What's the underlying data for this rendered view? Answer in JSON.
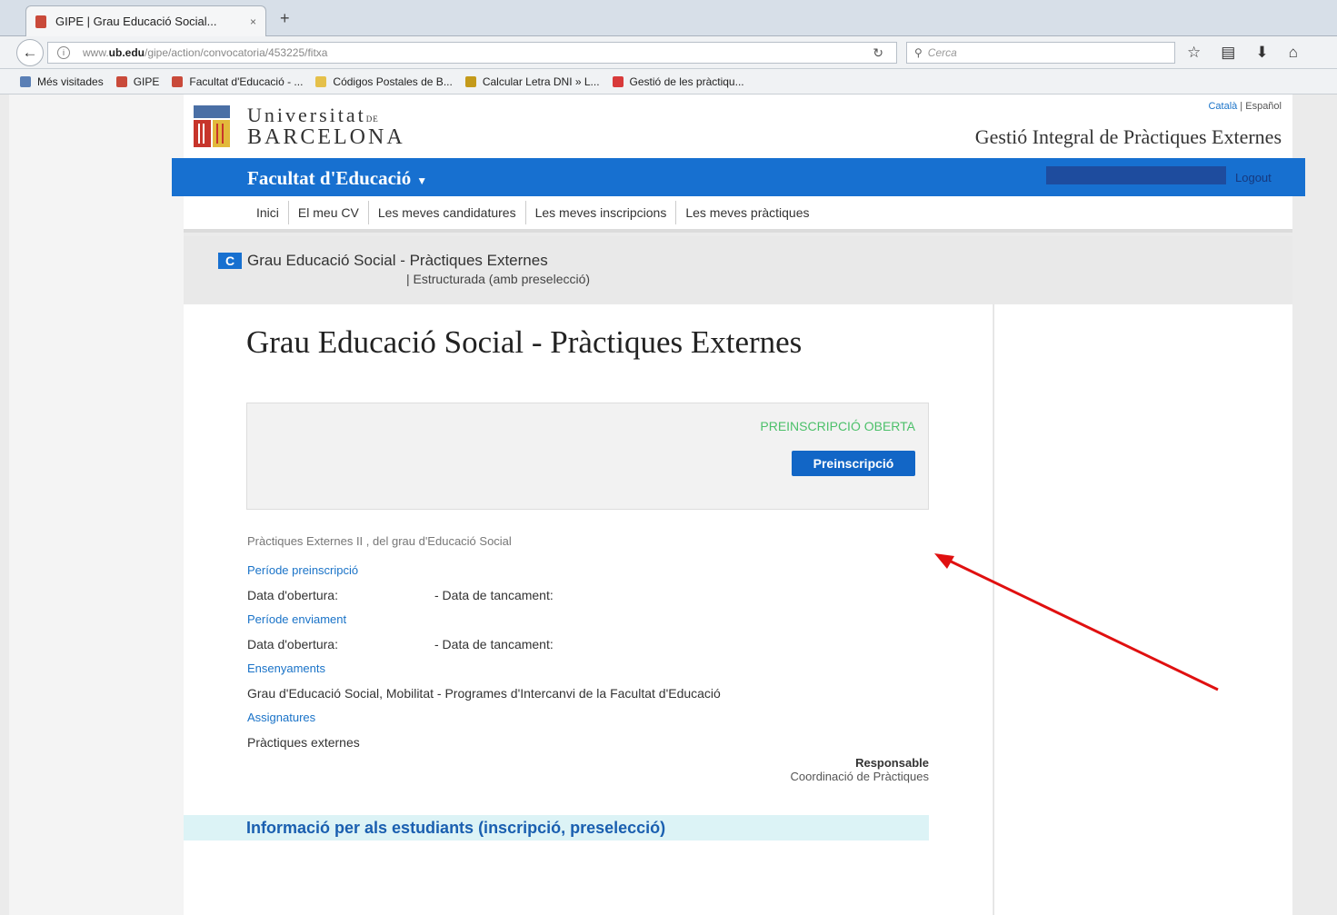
{
  "browser": {
    "tab_title": "GIPE | Grau Educació Social...",
    "tab_close": "×",
    "new_tab": "+",
    "url_prefix": "www.",
    "url_domain": "ub.edu",
    "url_path": "/gipe/action/convocatoria/453225/fitxa",
    "search_placeholder": "Cerca",
    "bookmarks": [
      {
        "label": "Més visitades",
        "color": "#5a7fb5"
      },
      {
        "label": "GIPE",
        "color": "#c94a3a"
      },
      {
        "label": "Facultat d'Educació - ...",
        "color": "#c94a3a"
      },
      {
        "label": "Códigos Postales de B...",
        "color": "#e5c04a"
      },
      {
        "label": "Calcular Letra DNI » L...",
        "color": "#c49a1a"
      },
      {
        "label": "Gestió de les pràctiqu...",
        "color": "#d83a3a"
      }
    ]
  },
  "header": {
    "uni_line1": "Universitat",
    "uni_de": "DE",
    "uni_line2": "BARCELONA",
    "lang_ca": "Català",
    "lang_sep": " | ",
    "lang_es": "Español",
    "app_title": "Gestió Integral de Pràctiques Externes"
  },
  "bluebar": {
    "faculty": "Facultat d'Educació",
    "logout": "Logout"
  },
  "menu": [
    "Inici",
    "El meu CV",
    "Les meves candidatures",
    "Les meves inscripcions",
    "Les meves pràctiques"
  ],
  "crumb": {
    "badge": "C",
    "title": "Grau Educació Social - Pràctiques Externes",
    "subtitle": "| Estructurada (amb preselecció)"
  },
  "main": {
    "title": "Grau Educació Social - Pràctiques Externes",
    "status": "PREINSCRIPCIÓ OBERTA",
    "button": "Preinscripció",
    "description": "Pràctiques Externes II , del grau d'Educació Social",
    "periode_preinscripcio": "Període preinscripció",
    "data_obertura_1": "Data d'obertura:",
    "data_tancament_1": "- Data de tancament:",
    "periode_enviament": "Període enviament",
    "data_obertura_2": "Data d'obertura:",
    "data_tancament_2": "- Data de tancament:",
    "ensenyaments_label": "Ensenyaments",
    "ensenyaments_value": "Grau d'Educació Social, Mobilitat - Programes d'Intercanvi de la Facultat d'Educació",
    "assignatures_label": "Assignatures",
    "assignatures_value": "Pràctiques externes",
    "responsable_label": "Responsable",
    "responsable_value": "Coordinació de Pràctiques",
    "info_bar": "Informació per als estudiants (inscripció, preselecció)"
  },
  "colors": {
    "brand_blue": "#1770d0",
    "status_green": "#4cc06a",
    "annotation_arrow": "#e01010"
  }
}
